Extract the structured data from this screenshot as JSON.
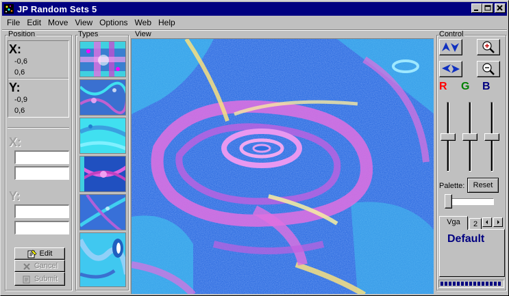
{
  "window": {
    "title": "JP Random Sets 5"
  },
  "titlebar_buttons": [
    "minimize",
    "maximize",
    "close"
  ],
  "menu": [
    "File",
    "Edit",
    "Move",
    "View",
    "Options",
    "Web",
    "Help"
  ],
  "position": {
    "label": "Position",
    "x_label": "X:",
    "x_values": [
      "-0,6",
      "0,6"
    ],
    "y_label": "Y:",
    "y_values": [
      "-0,9",
      "0,6"
    ],
    "edit_x_label": "X:",
    "edit_y_label": "Y:",
    "x_inputs": [
      "",
      ""
    ],
    "y_inputs": [
      "",
      ""
    ],
    "buttons": {
      "edit": "Edit",
      "cancel": "Cancel",
      "submit": "Submit"
    }
  },
  "types": {
    "label": "Types",
    "thumbnail_count": 6
  },
  "view": {
    "label": "View"
  },
  "control": {
    "label": "Control",
    "buttons": [
      "up-down-arrows",
      "zoom-in",
      "left-right-arrows",
      "zoom-out"
    ],
    "rgb_labels": [
      "R",
      "G",
      "B"
    ],
    "rgb_colors": [
      "#ff0000",
      "#008000",
      "#000080"
    ],
    "palette_label": "Palette:",
    "reset_label": "Reset",
    "tabs": [
      "Vga",
      "2"
    ],
    "palette_name": "Default",
    "progress_segments": 16
  },
  "colors": {
    "titlebar": "#000080",
    "face": "#c0c0c0",
    "palette_text": "#000080"
  }
}
